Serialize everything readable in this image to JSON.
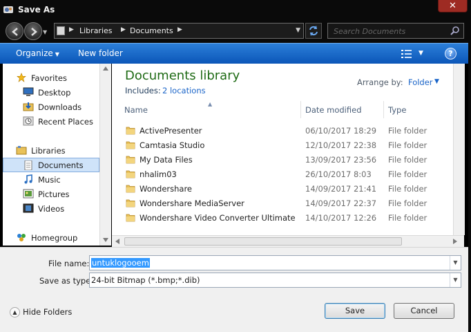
{
  "window": {
    "title": "Save As",
    "close_glyph": "✕"
  },
  "address": {
    "crumbs": [
      "Libraries",
      "Documents"
    ],
    "search_placeholder": "Search Documents"
  },
  "toolbar": {
    "organize_label": "Organize",
    "new_folder_label": "New folder",
    "help_label": "?"
  },
  "navpane": {
    "items": [
      {
        "label": "Favorites",
        "icon": "star-icon"
      },
      {
        "label": "Desktop",
        "icon": "desktop-icon"
      },
      {
        "label": "Downloads",
        "icon": "downloads-icon"
      },
      {
        "label": "Recent Places",
        "icon": "recent-places-icon"
      },
      {
        "label": "Libraries",
        "icon": "libraries-icon"
      },
      {
        "label": "Documents",
        "icon": "documents-icon",
        "selected": true
      },
      {
        "label": "Music",
        "icon": "music-icon"
      },
      {
        "label": "Pictures",
        "icon": "pictures-icon"
      },
      {
        "label": "Videos",
        "icon": "videos-icon"
      },
      {
        "label": "Homegroup",
        "icon": "homegroup-icon"
      }
    ]
  },
  "library": {
    "title": "Documents library",
    "includes_label": "Includes:",
    "includes_link": "2 locations",
    "arrange_label": "Arrange by:",
    "arrange_value": "Folder"
  },
  "columns": {
    "name": "Name",
    "date": "Date modified",
    "type": "Type"
  },
  "files": [
    {
      "name": "ActivePresenter",
      "date": "06/10/2017 18:29",
      "type": "File folder"
    },
    {
      "name": "Camtasia Studio",
      "date": "12/10/2017 22:38",
      "type": "File folder"
    },
    {
      "name": "My Data Files",
      "date": "13/09/2017 23:56",
      "type": "File folder"
    },
    {
      "name": "nhalim03",
      "date": "26/10/2017 8:03",
      "type": "File folder"
    },
    {
      "name": "Wondershare",
      "date": "14/09/2017 21:41",
      "type": "File folder"
    },
    {
      "name": "Wondershare MediaServer",
      "date": "14/09/2017 22:37",
      "type": "File folder"
    },
    {
      "name": "Wondershare Video Converter Ultimate",
      "date": "14/10/2017 12:26",
      "type": "File folder"
    }
  ],
  "form": {
    "filename_label": "File name:",
    "filename_value": "untuklogooem",
    "savetype_label": "Save as type:",
    "savetype_value": "24-bit Bitmap (*.bmp;*.dib)"
  },
  "footer": {
    "hide_folders_label": "Hide Folders",
    "save_label": "Save",
    "cancel_label": "Cancel"
  },
  "colors": {
    "toolbar_blue": "#0b56b8",
    "library_green": "#1e6a14",
    "link_blue": "#1a64c8",
    "selection_blue": "#3399ff",
    "close_red": "#9e2b23"
  }
}
